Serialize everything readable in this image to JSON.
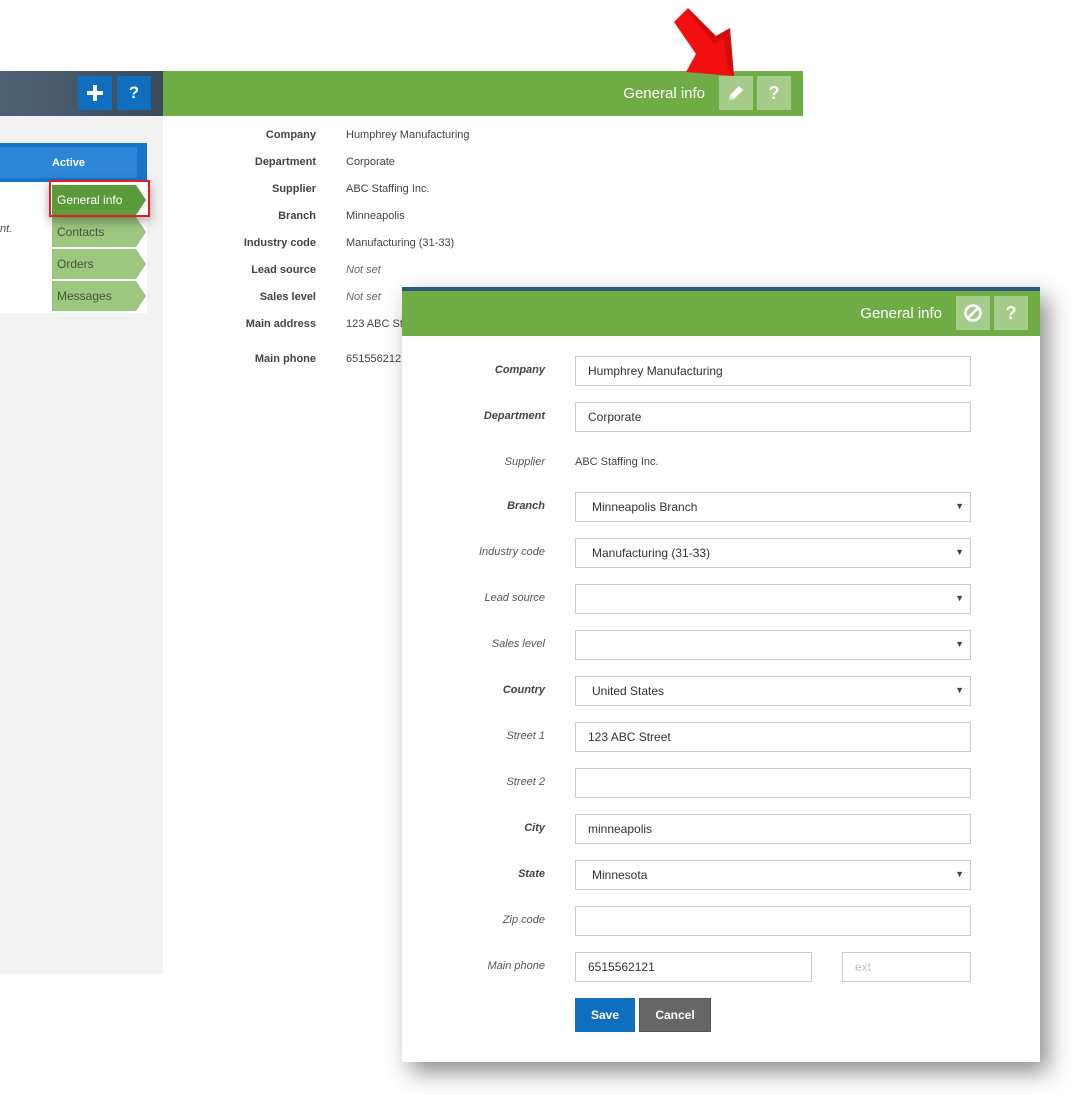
{
  "left": {
    "status": "Active",
    "text_fragment": "nt.",
    "tabs": [
      {
        "label": "General info"
      },
      {
        "label": "Contacts"
      },
      {
        "label": "Orders"
      },
      {
        "label": "Messages"
      }
    ]
  },
  "main": {
    "title": "General info",
    "details": [
      {
        "label": "Company",
        "value": "Humphrey Manufacturing"
      },
      {
        "label": "Department",
        "value": "Corporate"
      },
      {
        "label": "Supplier",
        "value": "ABC Staffing Inc."
      },
      {
        "label": "Branch",
        "value": "Minneapolis"
      },
      {
        "label": "Industry code",
        "value": "Manufacturing (31-33)"
      },
      {
        "label": "Lead source",
        "value": "Not set"
      },
      {
        "label": "Sales level",
        "value": "Not set"
      },
      {
        "label": "Main address",
        "value": "123 ABC St"
      },
      {
        "label": "Main phone",
        "value": "651556212"
      }
    ]
  },
  "modal": {
    "title": "General info",
    "fields": {
      "company": {
        "label": "Company",
        "value": "Humphrey Manufacturing"
      },
      "department": {
        "label": "Department",
        "value": "Corporate"
      },
      "supplier": {
        "label": "Supplier",
        "value": "ABC Staffing Inc."
      },
      "branch": {
        "label": "Branch",
        "value": "Minneapolis Branch"
      },
      "industry_code": {
        "label": "Industry code",
        "value": "Manufacturing (31-33)"
      },
      "lead_source": {
        "label": "Lead source",
        "value": ""
      },
      "sales_level": {
        "label": "Sales level",
        "value": ""
      },
      "country": {
        "label": "Country",
        "value": "United States"
      },
      "street1": {
        "label": "Street 1",
        "value": "123 ABC Street"
      },
      "street2": {
        "label": "Street 2",
        "value": ""
      },
      "city": {
        "label": "City",
        "value": "minneapolis"
      },
      "state": {
        "label": "State",
        "value": "Minnesota"
      },
      "zip": {
        "label": "Zip code",
        "value": ""
      },
      "phone": {
        "label": "Main phone",
        "value": "6515562121",
        "ext_placeholder": "ext"
      }
    },
    "save_label": "Save",
    "cancel_label": "Cancel"
  },
  "icons": {
    "add": "plus-icon",
    "help": "question-icon",
    "edit": "pencil-icon",
    "cancel": "block-icon",
    "pointer": "red-arrow-icon"
  },
  "colors": {
    "green": "#70ac45",
    "blue": "#0f6ebd",
    "tab": "#9cc77e",
    "tab_active": "#5b9a3a",
    "highlight": "#e02020"
  }
}
